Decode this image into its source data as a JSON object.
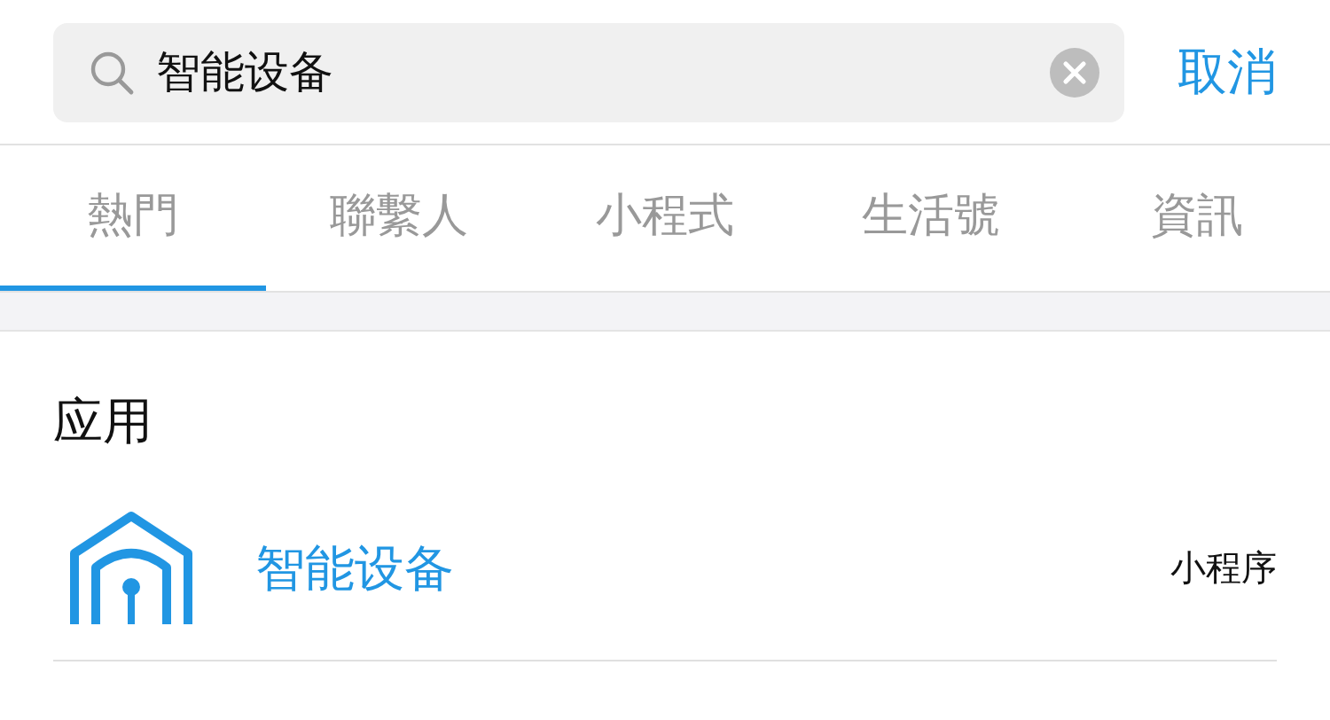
{
  "search": {
    "value": "智能设备",
    "cancel": "取消"
  },
  "tabs": [
    {
      "label": "熱門",
      "selected": true
    },
    {
      "label": "聯繫人",
      "selected": false
    },
    {
      "label": "小程式",
      "selected": false
    },
    {
      "label": "生活號",
      "selected": false
    },
    {
      "label": "資訊",
      "selected": false
    }
  ],
  "section": {
    "title": "应用",
    "results": [
      {
        "title": "智能设备",
        "tag": "小程序"
      }
    ]
  }
}
